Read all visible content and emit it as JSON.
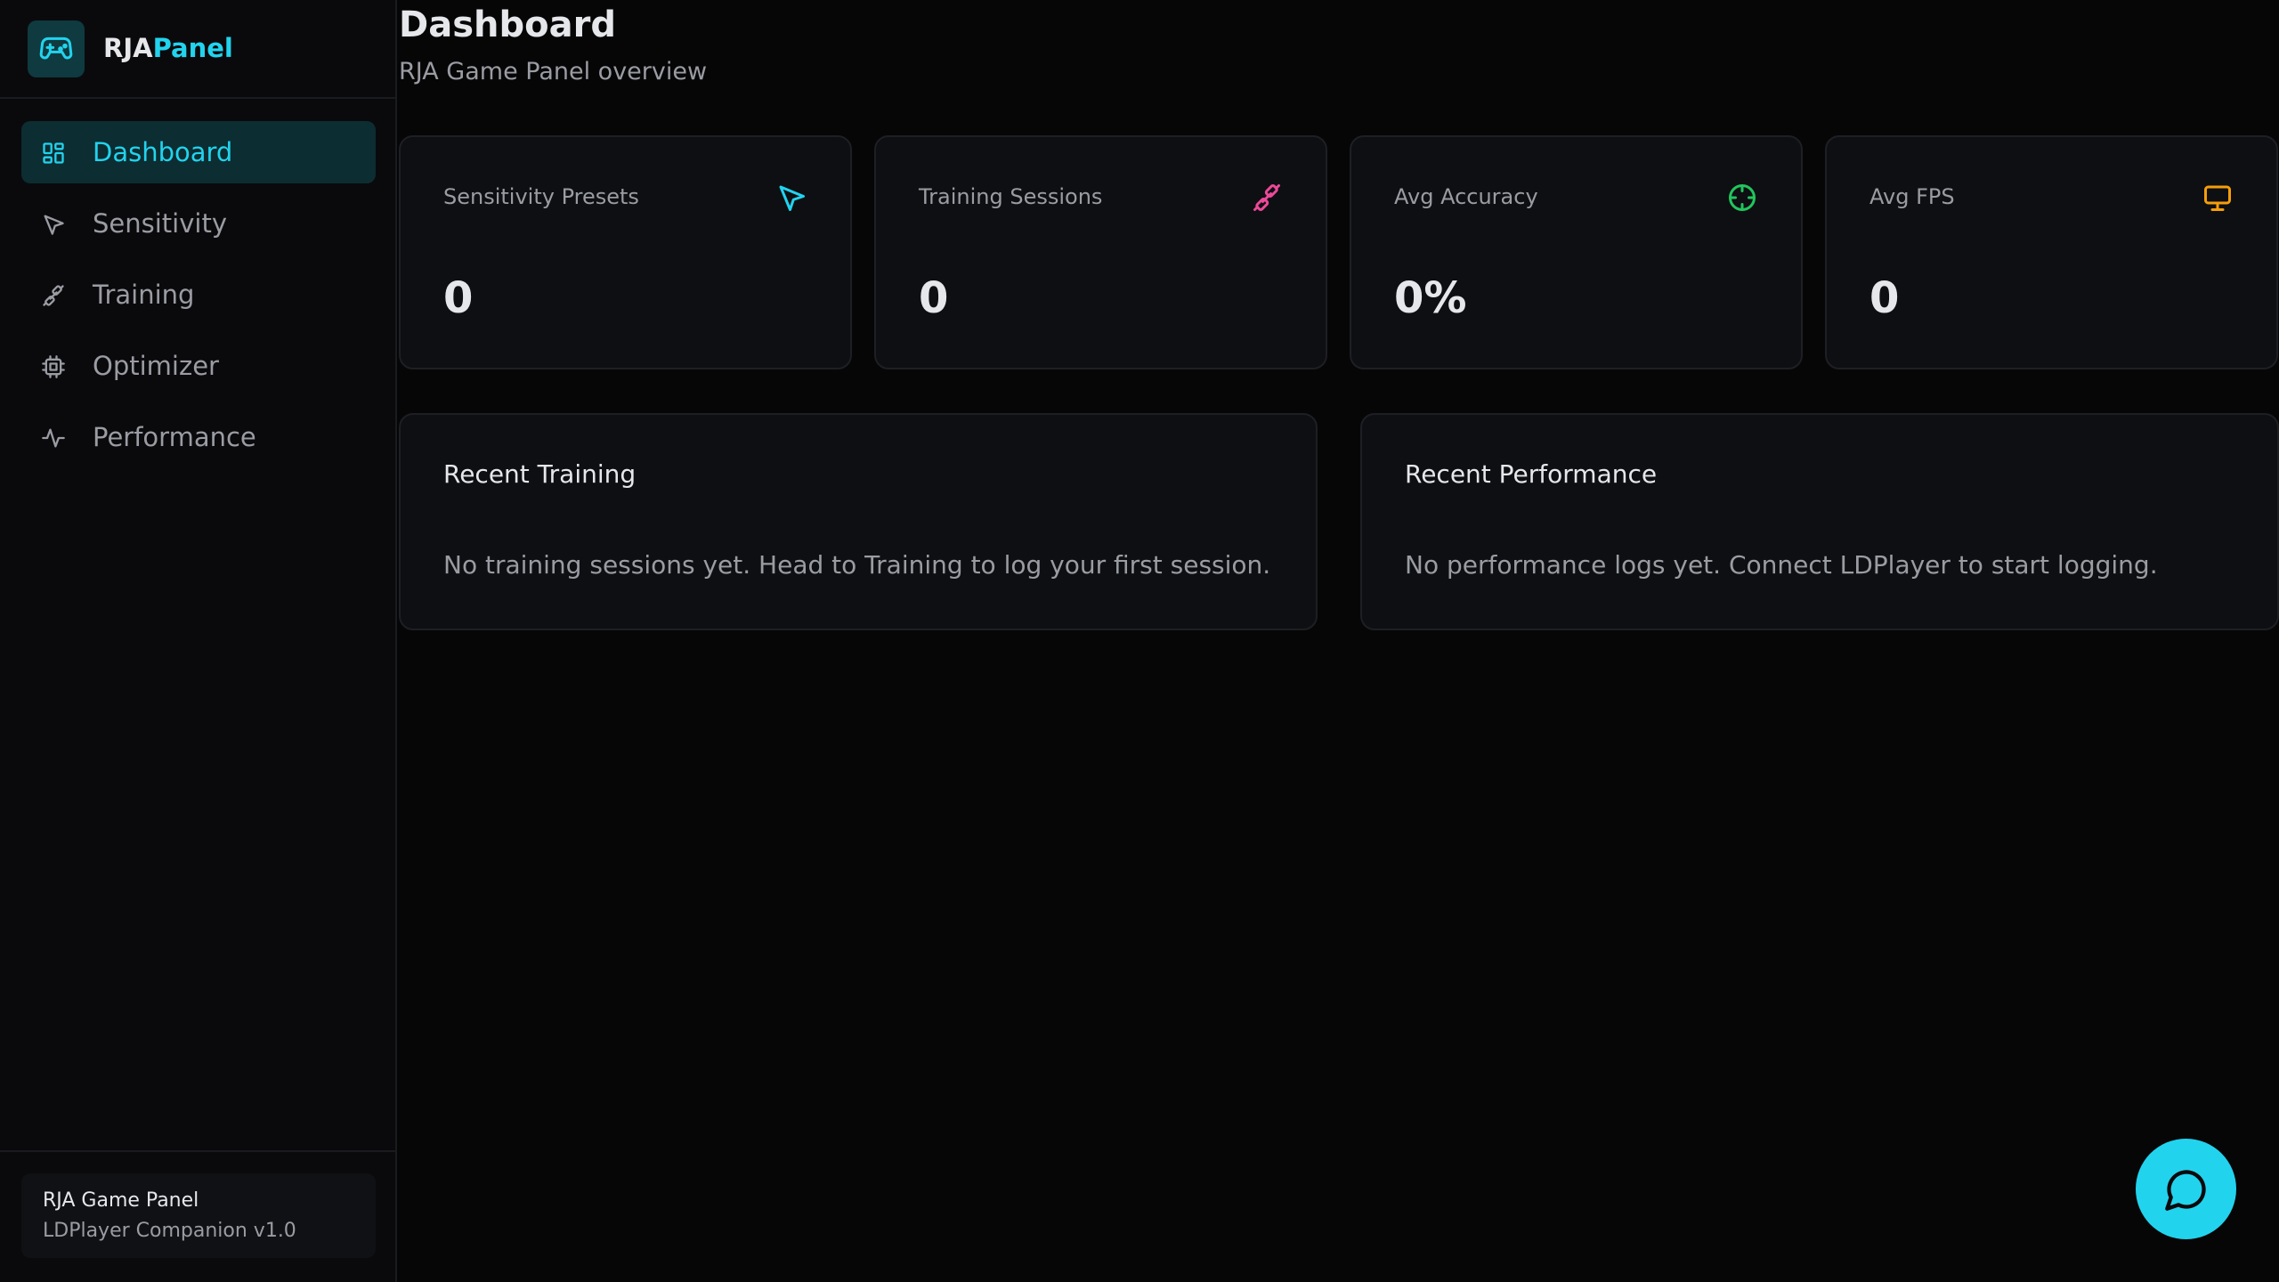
{
  "brand": {
    "name_part1": "RJA",
    "name_part2": "Panel",
    "logo_icon": "gamepad-icon",
    "accent": "#22d3ee"
  },
  "sidebar": {
    "items": [
      {
        "label": "Dashboard",
        "icon": "grid-icon",
        "active": true
      },
      {
        "label": "Sensitivity",
        "icon": "cursor-icon",
        "active": false
      },
      {
        "label": "Training",
        "icon": "dumbbell-icon",
        "active": false
      },
      {
        "label": "Optimizer",
        "icon": "chip-icon",
        "active": false
      },
      {
        "label": "Performance",
        "icon": "activity-icon",
        "active": false
      }
    ],
    "footer": {
      "title": "RJA Game Panel",
      "subtitle": "LDPlayer Companion v1.0"
    }
  },
  "header": {
    "title": "Dashboard",
    "subtitle": "RJA Game Panel overview"
  },
  "stats": [
    {
      "label": "Sensitivity Presets",
      "value": "0",
      "icon": "cursor-icon",
      "color": "#22d3ee"
    },
    {
      "label": "Training Sessions",
      "value": "0",
      "icon": "dumbbell-icon",
      "color": "#ec4899"
    },
    {
      "label": "Avg Accuracy",
      "value": "0%",
      "icon": "crosshair-icon",
      "color": "#22c55e"
    },
    {
      "label": "Avg FPS",
      "value": "0",
      "icon": "monitor-icon",
      "color": "#f59e0b"
    }
  ],
  "panels": {
    "recent_training": {
      "title": "Recent Training",
      "empty": "No training sessions yet. Head to Training to log your first session."
    },
    "recent_performance": {
      "title": "Recent Performance",
      "empty": "No performance logs yet. Connect LDPlayer to start logging."
    }
  },
  "chat_button": {
    "icon": "chat-bubble-icon"
  }
}
